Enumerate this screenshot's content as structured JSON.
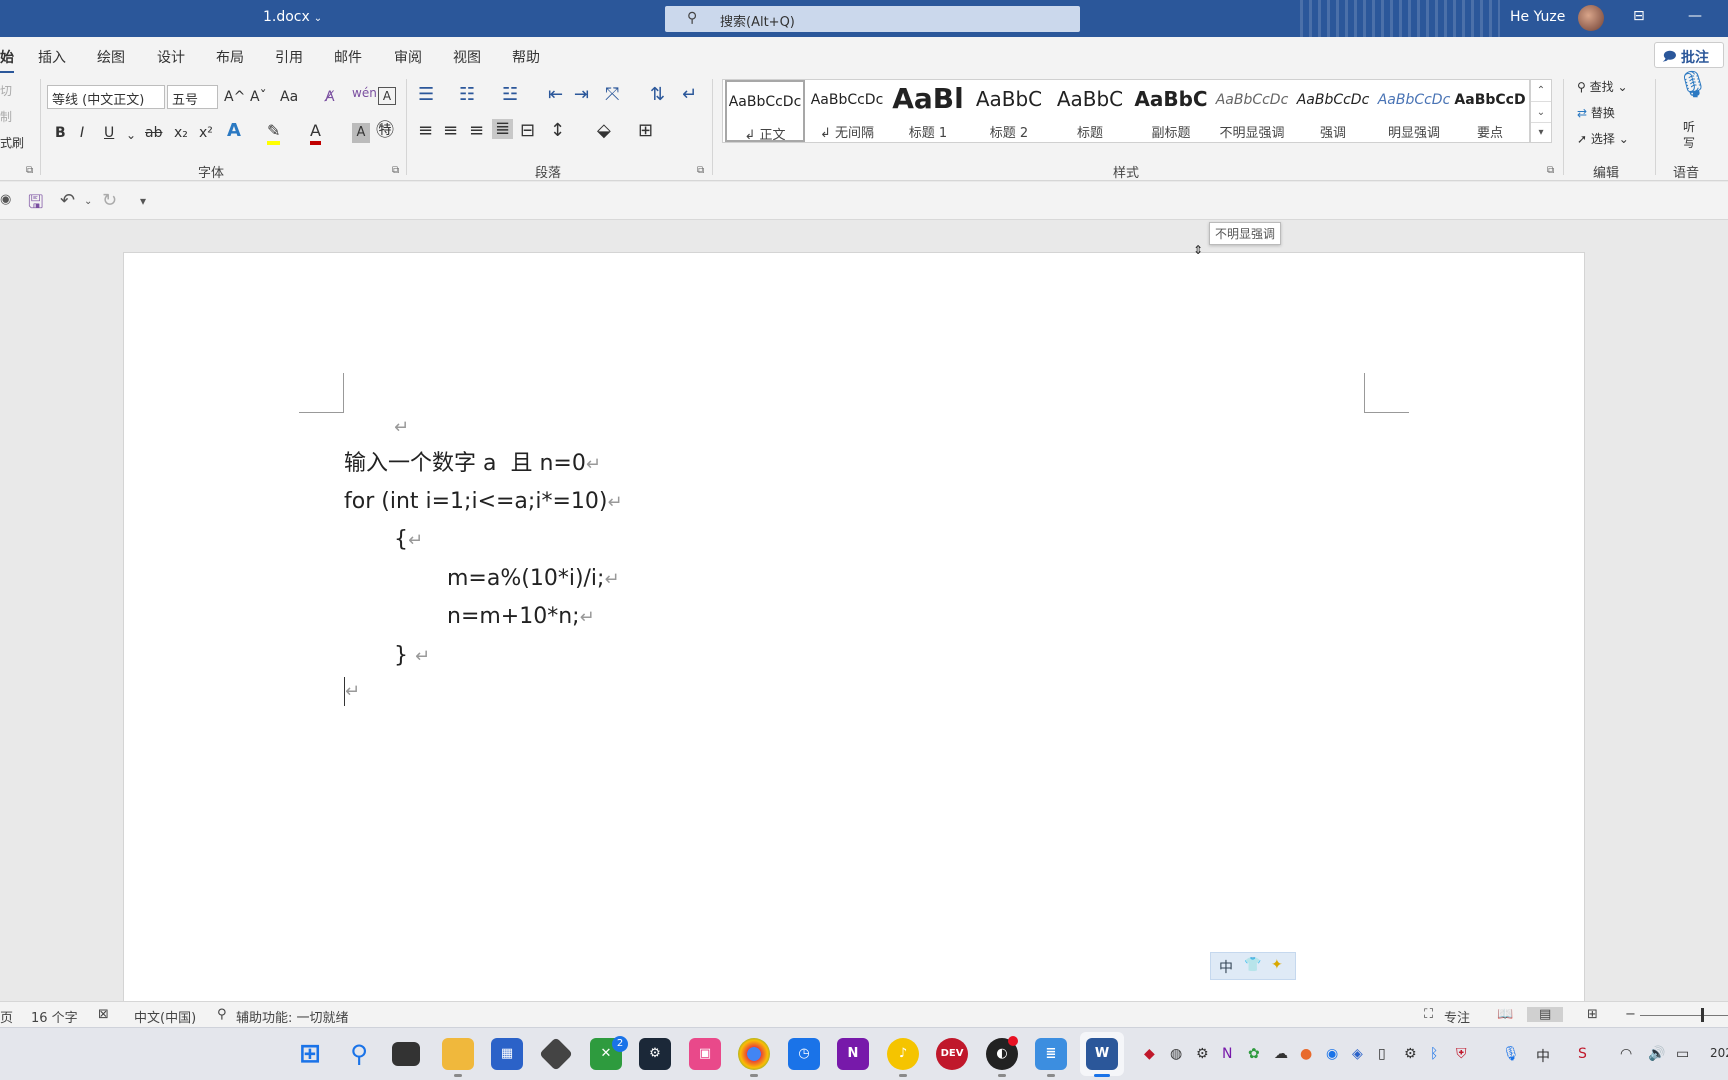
{
  "titlebar": {
    "doc_title": "1.docx",
    "search_placeholder": "搜索(Alt+Q)",
    "user_name": "He Yuze"
  },
  "tabs": [
    "始",
    "插入",
    "绘图",
    "设计",
    "布局",
    "引用",
    "邮件",
    "审阅",
    "视图",
    "帮助"
  ],
  "comment_button": "批注",
  "clipboard": {
    "cut": "切",
    "copy": "制",
    "format_painter": "式刷"
  },
  "font": {
    "family": "等线 (中文正文)",
    "size": "五号",
    "group_label": "字体",
    "grow": "A^",
    "shrink": "Aˇ",
    "change_case": "Aa",
    "bold": "B",
    "italic": "I",
    "underline": "U",
    "strike": "ab",
    "subscript": "x₂",
    "superscript": "x²",
    "effects": "A",
    "font_color": "A",
    "shading": "A",
    "phonetic": "wén"
  },
  "paragraph": {
    "group_label": "段落"
  },
  "styles": {
    "group_label": "样式",
    "items": [
      {
        "preview": "AaBbCcDc",
        "name": "↲ 正文"
      },
      {
        "preview": "AaBbCcDc",
        "name": "↲ 无间隔"
      },
      {
        "preview": "AaBl",
        "name": "标题 1"
      },
      {
        "preview": "AaBbC",
        "name": "标题 2"
      },
      {
        "preview": "AaBbC",
        "name": "标题"
      },
      {
        "preview": "AaBbC",
        "name": "副标题"
      },
      {
        "preview": "AaBbCcDc",
        "name": "不明显强调"
      },
      {
        "preview": "AaBbCcDc",
        "name": "强调"
      },
      {
        "preview": "AaBbCcDc",
        "name": "明显强调"
      },
      {
        "preview": "AaBbCcD",
        "name": "要点"
      }
    ]
  },
  "editing": {
    "group_label": "编辑",
    "find": "查找",
    "replace": "替换",
    "select": "选择"
  },
  "voice": {
    "group_label": "语音",
    "dictate_1": "听",
    "dictate_2": "写"
  },
  "tooltip": "不明显强调",
  "document": {
    "lines": [
      {
        "text": "",
        "mark": "↵"
      },
      {
        "text": "输入一个数字 a  且 n=0",
        "mark": "↵"
      },
      {
        "text": "for (int i=1;i<=a;i*=10)",
        "mark": "↵"
      },
      {
        "text": "{",
        "mark": "↵"
      },
      {
        "text": "m=a%(10*i)/i;",
        "mark": "↵"
      },
      {
        "text": "n=m+10*n;",
        "mark": "↵"
      },
      {
        "text": "} ",
        "mark": "↵"
      },
      {
        "text": "",
        "mark": "↵"
      }
    ]
  },
  "ime": {
    "mode": "中"
  },
  "status": {
    "page": "页",
    "word_count": "16 个字",
    "language": "中文(中国)",
    "accessibility": "辅助功能: 一切就绪",
    "focus": "专注"
  },
  "taskbar": {
    "badge_count": "2",
    "clock_partial": "202"
  },
  "colors": {
    "title_bar": "#2b579a",
    "accent": "#2b579a",
    "highlight": "#ffff00",
    "font_color": "#c00000"
  }
}
